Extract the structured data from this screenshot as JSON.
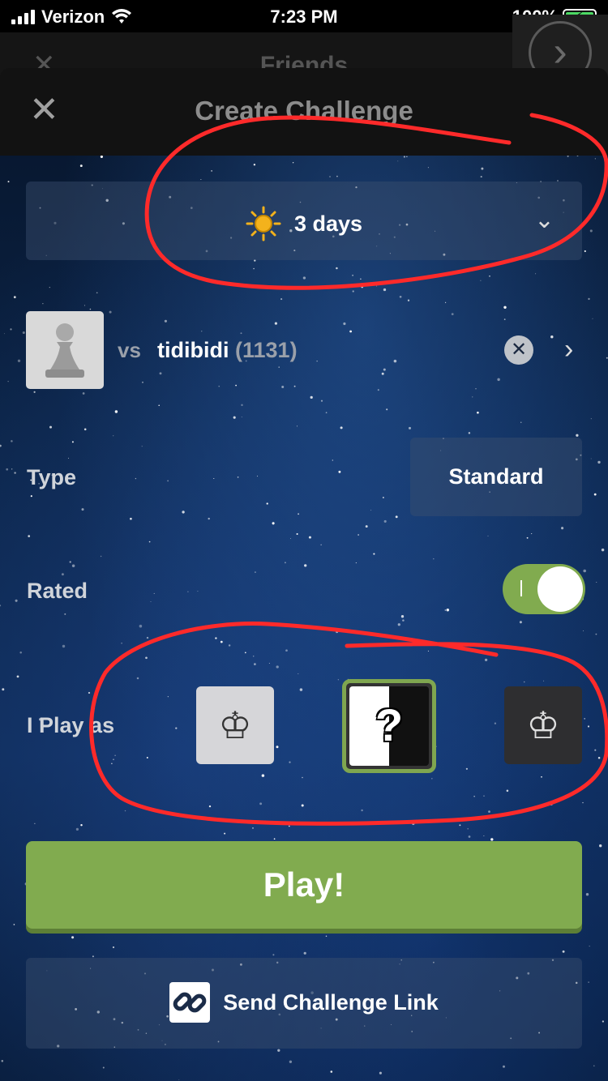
{
  "status_bar": {
    "carrier": "Verizon",
    "time": "7:23 PM",
    "battery": "100%"
  },
  "background_screen": {
    "title": "Friends"
  },
  "modal": {
    "title": "Create Challenge",
    "close_icon": "close-icon"
  },
  "time_control": {
    "icon": "sun-icon",
    "label": "3 days"
  },
  "opponent": {
    "vs_label": "vs",
    "username": "tidibidi",
    "rating": "(1131)"
  },
  "type": {
    "label": "Type",
    "value": "Standard"
  },
  "rated": {
    "label": "Rated",
    "enabled": true
  },
  "play_as": {
    "label": "I Play as",
    "options": [
      "white",
      "random",
      "black"
    ],
    "random_glyph": "?",
    "selected": "random"
  },
  "actions": {
    "play_label": "Play!",
    "link_label": "Send Challenge Link"
  },
  "colors": {
    "accent_green": "#81ab4f",
    "annotation_red": "#ff2a2a"
  }
}
